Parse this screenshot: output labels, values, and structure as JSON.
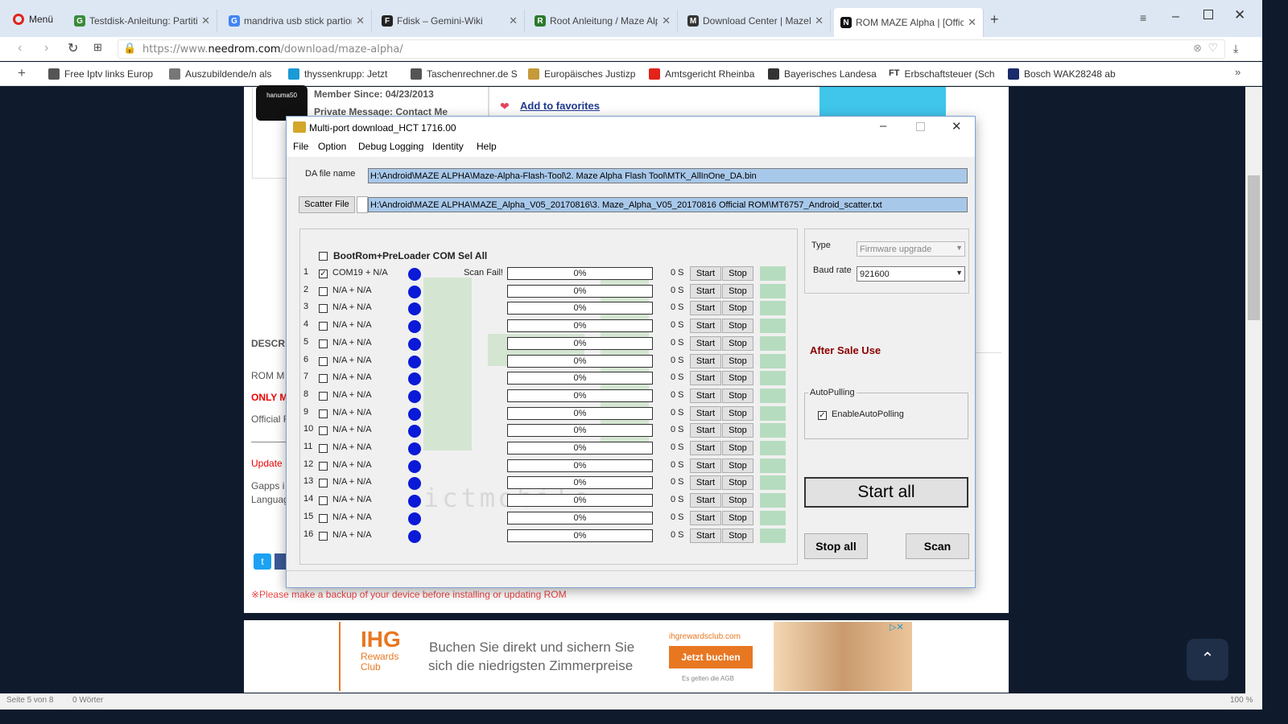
{
  "browser": {
    "menu_label": "Menü",
    "tabs": [
      {
        "title": "Testdisk-Anleitung: Partitio",
        "icon": "G"
      },
      {
        "title": "mandriva usb stick partion",
        "icon": "G"
      },
      {
        "title": "Fdisk – Gemini-Wiki",
        "icon": "F"
      },
      {
        "title": "Root Anleitung / Maze Alp",
        "icon": "R"
      },
      {
        "title": "Download Center | MazeM",
        "icon": "M"
      },
      {
        "title": "ROM MAZE Alpha | [Offici",
        "icon": "N"
      }
    ],
    "url_prefix": "https://www.",
    "url_domain": "needrom.com",
    "url_path": "/download/maze-alpha/",
    "bookmarks": [
      "Free Iptv links Europ",
      "Auszubildende/n als",
      "thyssenkrupp: Jetzt",
      "Taschenrechner.de S",
      "Europäisches Justizp",
      "Amtsgericht Rheinba",
      "Bayerisches Landesa",
      "Erbschaftsteuer (Sch",
      "Bosch WAK28248 ab"
    ],
    "bookmark_ft_glyph": "FT"
  },
  "webpage": {
    "member_since": "Member Since: 04/23/2013",
    "private_message": "Private Message: Contact Me",
    "add_favorites": "Add to favorites",
    "descr_heading": "DESCR",
    "rom_text": "ROM M",
    "only_text": "ONLY M",
    "official_text": "Official F",
    "update_text": "Update",
    "gapps_text": "Gapps i",
    "language_text": "Languag",
    "backup_warning": "※Please make a backup of your device before installing or updating ROM",
    "avatar_text": "hanuma50"
  },
  "dialog": {
    "title": "Multi-port download_HCT 1716.00",
    "menu": [
      "File",
      "Option",
      "Debug Logging",
      "Identity",
      "Help"
    ],
    "da_label": "DA file name",
    "da_value": "H:\\Android\\MAZE ALPHA\\Maze-Alpha-Flash-Tool\\2. Maze Alpha Flash Tool\\MTK_AllInOne_DA.bin",
    "scatter_button": "Scatter File",
    "scatter_value": "H:\\Android\\MAZE ALPHA\\MAZE_Alpha_V05_20170816\\3. Maze_Alpha_V05_20170816 Official ROM\\MT6757_Android_scatter.txt",
    "select_all_label": "BootRom+PreLoader COM Sel All",
    "rows": [
      {
        "num": "1",
        "com": "COM19 + N/A",
        "checked": true,
        "status": "Scan Fail!",
        "progress": "0%",
        "time": "0 S"
      },
      {
        "num": "2",
        "com": "N/A + N/A",
        "checked": false,
        "status": "",
        "progress": "0%",
        "time": "0 S"
      },
      {
        "num": "3",
        "com": "N/A + N/A",
        "checked": false,
        "status": "",
        "progress": "0%",
        "time": "0 S"
      },
      {
        "num": "4",
        "com": "N/A + N/A",
        "checked": false,
        "status": "",
        "progress": "0%",
        "time": "0 S"
      },
      {
        "num": "5",
        "com": "N/A + N/A",
        "checked": false,
        "status": "",
        "progress": "0%",
        "time": "0 S"
      },
      {
        "num": "6",
        "com": "N/A + N/A",
        "checked": false,
        "status": "",
        "progress": "0%",
        "time": "0 S"
      },
      {
        "num": "7",
        "com": "N/A + N/A",
        "checked": false,
        "status": "",
        "progress": "0%",
        "time": "0 S"
      },
      {
        "num": "8",
        "com": "N/A + N/A",
        "checked": false,
        "status": "",
        "progress": "0%",
        "time": "0 S"
      },
      {
        "num": "9",
        "com": "N/A + N/A",
        "checked": false,
        "status": "",
        "progress": "0%",
        "time": "0 S"
      },
      {
        "num": "10",
        "com": "N/A + N/A",
        "checked": false,
        "status": "",
        "progress": "0%",
        "time": "0 S"
      },
      {
        "num": "11",
        "com": "N/A + N/A",
        "checked": false,
        "status": "",
        "progress": "0%",
        "time": "0 S"
      },
      {
        "num": "12",
        "com": "N/A + N/A",
        "checked": false,
        "status": "",
        "progress": "0%",
        "time": "0 S"
      },
      {
        "num": "13",
        "com": "N/A + N/A",
        "checked": false,
        "status": "",
        "progress": "0%",
        "time": "0 S"
      },
      {
        "num": "14",
        "com": "N/A + N/A",
        "checked": false,
        "status": "",
        "progress": "0%",
        "time": "0 S"
      },
      {
        "num": "15",
        "com": "N/A + N/A",
        "checked": false,
        "status": "",
        "progress": "0%",
        "time": "0 S"
      },
      {
        "num": "16",
        "com": "N/A + N/A",
        "checked": false,
        "status": "",
        "progress": "0%",
        "time": "0 S"
      }
    ],
    "start_label": "Start",
    "stop_label": "Stop",
    "type_label": "Type",
    "type_value": "Firmware upgrade",
    "baud_label": "Baud rate",
    "baud_value": "921600",
    "after_sale": "After Sale Use",
    "autopulling_group": "AutoPulling",
    "enable_autopolling": "EnableAutoPolling",
    "start_all": "Start all",
    "stop_all": "Stop all",
    "scan": "Scan",
    "watermark": "ictmobile"
  },
  "ad": {
    "brand": "IHG",
    "brand_sub1": "Rewards",
    "brand_sub2": "Club",
    "line1": "Buchen Sie direkt und sichern Sie",
    "line2": "sich die niedrigsten Zimmerpreise",
    "site": "ihgrewardsclub.com",
    "cta": "Jetzt buchen",
    "fine": "Es gelten die AGB"
  },
  "statusbar": {
    "left1": "Seite 5 von 8",
    "left2": "0 Wörter",
    "zoom": "100 %"
  },
  "colors": {
    "accent_blue": "#0a1ad6",
    "field_blue": "#a8c8ea",
    "green_cell": "#b6dcbf",
    "after_sale_red": "#8b0000",
    "ad_orange": "#e87722"
  }
}
